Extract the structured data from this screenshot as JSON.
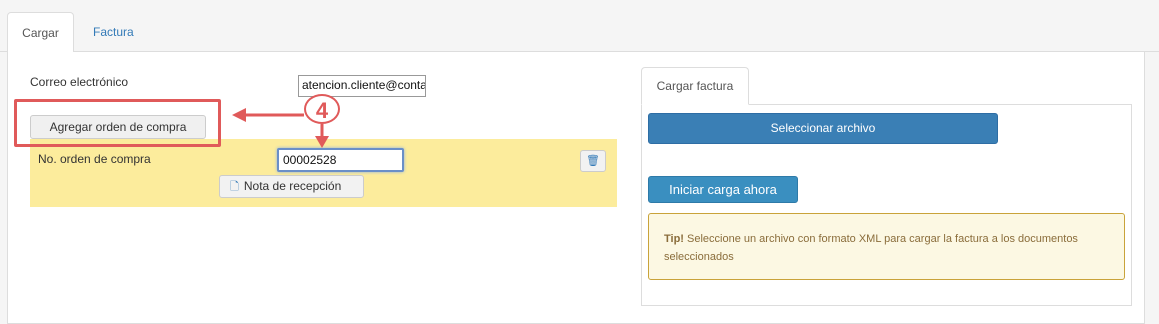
{
  "tabs": [
    {
      "label": "Cargar"
    },
    {
      "label": "Factura"
    }
  ],
  "form": {
    "email_label": "Correo electrónico",
    "email_value": "atencion.cliente@conta",
    "add_order_label": "Agregar orden de compra",
    "order_label": "No. orden de compra",
    "order_value": "00002528",
    "nota_label": "Nota de recepción"
  },
  "annotation": {
    "step": "4"
  },
  "upload": {
    "tab_label": "Cargar factura",
    "select_label": "Seleccionar archivo",
    "start_label": "Iniciar carga ahora",
    "tip_bold": "Tip!",
    "tip_text": " Seleccione un archivo con formato XML para cargar la factura a los documentos seleccionados"
  },
  "icons": {
    "trash": "trash-icon",
    "document": "document-icon"
  },
  "colors": {
    "primary": "#3a7fb5",
    "annotation": "#e05a5a",
    "row_highlight": "#fcec9c",
    "tip_bg": "#fcf8e3"
  }
}
